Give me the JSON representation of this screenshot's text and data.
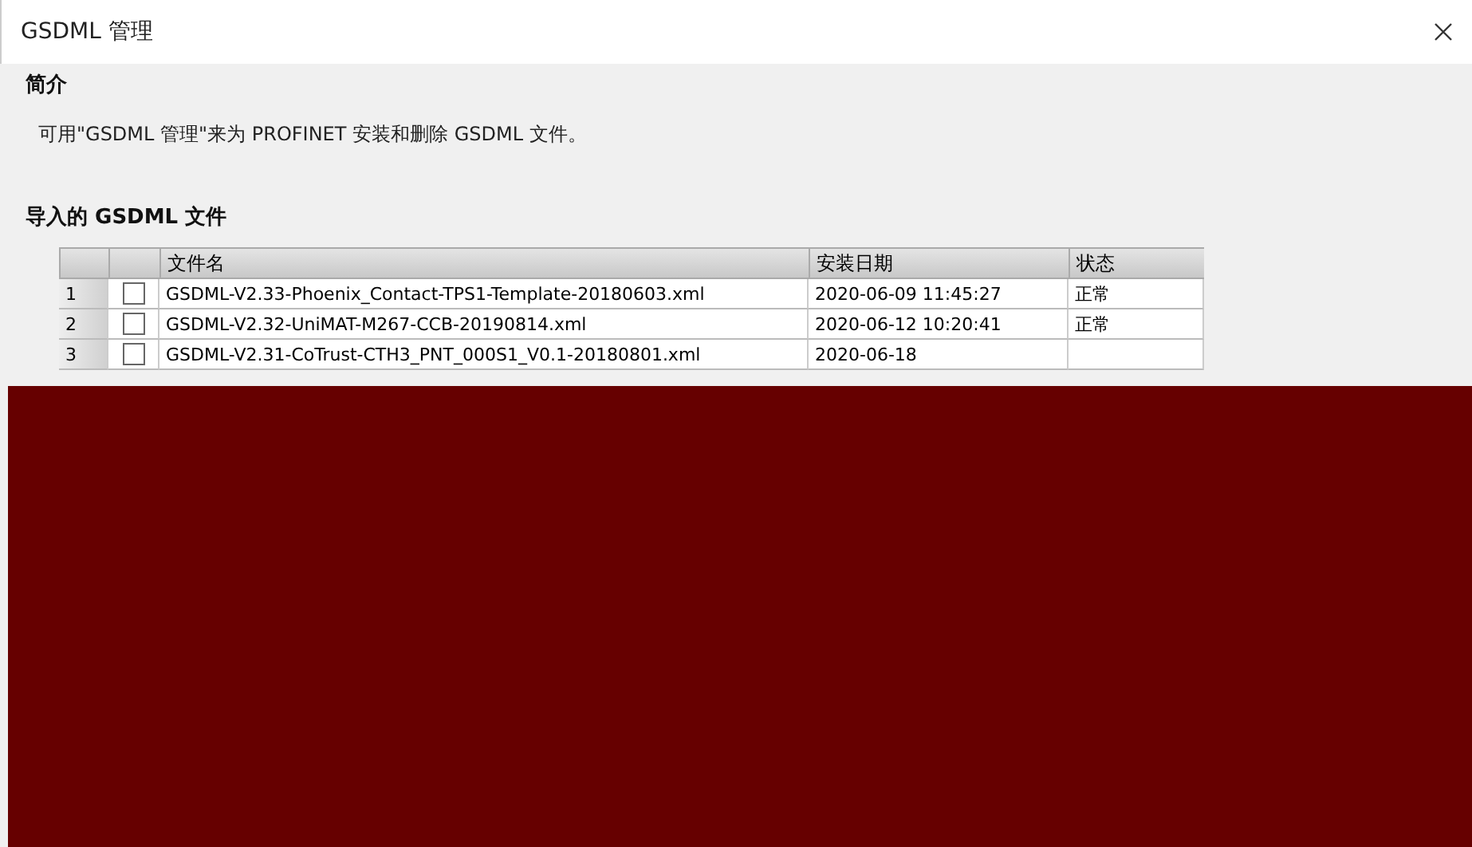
{
  "window": {
    "title": "GSDML 管理"
  },
  "intro": {
    "heading": "简介",
    "text": "可用\"GSDML 管理\"来为 PROFINET 安装和删除 GSDML 文件。"
  },
  "imported": {
    "heading": "导入的 GSDML 文件",
    "columns": [
      "文件名",
      "安装日期",
      "状态"
    ],
    "rows": [
      {
        "index": "1",
        "checked": false,
        "file": "GSDML-V2.33-Phoenix_Contact-TPS1-Template-20180603.xml",
        "date": "2020-06-09 11:45:27",
        "status": "正常"
      },
      {
        "index": "2",
        "checked": false,
        "file": "GSDML-V2.32-UniMAT-M267-CCB-20190814.xml",
        "date": "2020-06-12 10:20:41",
        "status": "正常"
      },
      {
        "index": "3",
        "checked": false,
        "file": "GSDML-V2.31-CoTrust-CTH3_PNT_000S1_V0.1-20180801.xml",
        "date": "2020-06-18"
      }
    ]
  }
}
